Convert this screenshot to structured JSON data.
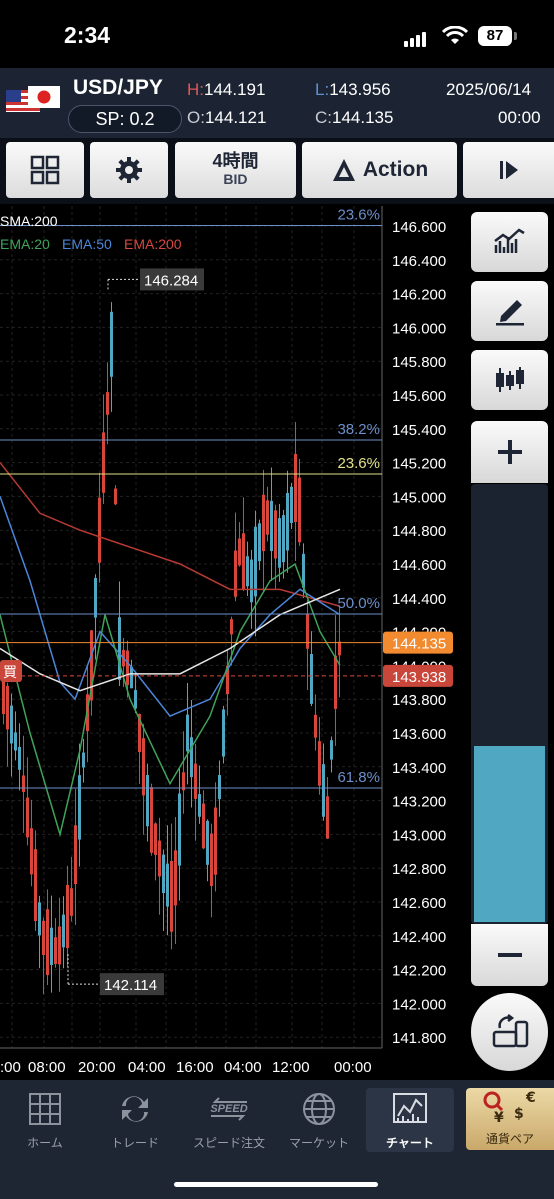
{
  "status_bar": {
    "time": "2:34",
    "battery": "87"
  },
  "header": {
    "pair": "USD/JPY",
    "spread": "SP: 0.2",
    "high_label": "H:",
    "high": "144.191",
    "low_label": "L:",
    "low": "143.956",
    "open_label": "O:",
    "open": "144.121",
    "close_label": "C:",
    "close": "144.135",
    "date": "2025/06/14",
    "time": "00:00"
  },
  "toolbar": {
    "timeframe": "4時間",
    "price_type": "BID",
    "action": "Action"
  },
  "indicators": {
    "sma": "SMA:200",
    "ema20": "EMA:20",
    "ema50": "EMA:50",
    "ema200": "EMA:200"
  },
  "fib_labels": {
    "top_a": "23.6%",
    "a": "38.2%",
    "b": "23.6%",
    "c": "50.0%",
    "d": "61.8%"
  },
  "price_tags": {
    "current": "144.135",
    "ask": "143.938",
    "high": "146.284",
    "low": "142.114",
    "buy_marker": "買"
  },
  "y_axis_labels": [
    "146.600",
    "146.400",
    "146.200",
    "146.000",
    "145.800",
    "145.600",
    "145.400",
    "145.200",
    "145.000",
    "144.800",
    "144.600",
    "144.400",
    "144.200",
    "144.000",
    "143.800",
    "143.600",
    "143.400",
    "143.200",
    "143.000",
    "142.800",
    "142.600",
    "142.400",
    "142.200",
    "142.000",
    "141.800"
  ],
  "x_axis_labels": [
    ":00",
    "08:00",
    "20:00",
    "04:00",
    "16:00",
    "04:00",
    "12:00",
    "00:00"
  ],
  "colors": {
    "bull": "#4fa7c1",
    "bear": "#d9453a",
    "ema20": "#3fa35a",
    "ema50": "#4c86d8",
    "ema200": "#b83a33",
    "sma200": "#e6e6e6",
    "fib_blue": "#6c8fc9",
    "fib_yellow": "#e2e08a",
    "current": "#f28b30"
  },
  "nav": [
    {
      "label": "ホーム",
      "icon": "home-grid-icon"
    },
    {
      "label": "トレード",
      "icon": "trade-arrows-icon"
    },
    {
      "label": "スピード注文",
      "icon": "speed-icon"
    },
    {
      "label": "マーケット",
      "icon": "globe-icon"
    },
    {
      "label": "チャート",
      "icon": "chart-icon"
    },
    {
      "label": "通貨ペア",
      "icon": "currency-pair-icon"
    }
  ]
}
